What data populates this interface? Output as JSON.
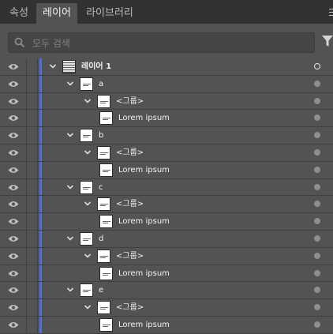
{
  "tabs": [
    {
      "label": "속성",
      "active": false
    },
    {
      "label": "레이어",
      "active": true
    },
    {
      "label": "라이브러리",
      "active": false
    }
  ],
  "search": {
    "placeholder": "모두 검색"
  },
  "accent_color": "#4f6ee0",
  "rows": [
    {
      "level": 0,
      "kind": "layer",
      "label": "레이어 1",
      "target": "hollow",
      "expanded": true
    },
    {
      "level": 1,
      "kind": "group",
      "label": "a",
      "target": "filled",
      "expanded": true
    },
    {
      "level": 2,
      "kind": "group",
      "label": "<그룹>",
      "target": "filled",
      "expanded": true
    },
    {
      "level": 3,
      "kind": "text",
      "label": "Lorem ipsum",
      "target": "filled"
    },
    {
      "level": 1,
      "kind": "group",
      "label": "b",
      "target": "filled",
      "expanded": true
    },
    {
      "level": 2,
      "kind": "group",
      "label": "<그룹>",
      "target": "filled",
      "expanded": true
    },
    {
      "level": 3,
      "kind": "text",
      "label": "Lorem ipsum",
      "target": "filled"
    },
    {
      "level": 1,
      "kind": "group",
      "label": "c",
      "target": "filled",
      "expanded": true
    },
    {
      "level": 2,
      "kind": "group",
      "label": "<그룹>",
      "target": "filled",
      "expanded": true
    },
    {
      "level": 3,
      "kind": "text",
      "label": "Lorem ipsum",
      "target": "filled"
    },
    {
      "level": 1,
      "kind": "group",
      "label": "d",
      "target": "filled",
      "expanded": true
    },
    {
      "level": 2,
      "kind": "group",
      "label": "<그룹>",
      "target": "filled",
      "expanded": true
    },
    {
      "level": 3,
      "kind": "text",
      "label": "Lorem ipsum",
      "target": "filled"
    },
    {
      "level": 1,
      "kind": "group",
      "label": "e",
      "target": "filled",
      "expanded": true
    },
    {
      "level": 2,
      "kind": "group",
      "label": "<그룹>",
      "target": "filled",
      "expanded": true
    },
    {
      "level": 3,
      "kind": "text",
      "label": "Lorem ipsum",
      "target": "filled"
    }
  ]
}
